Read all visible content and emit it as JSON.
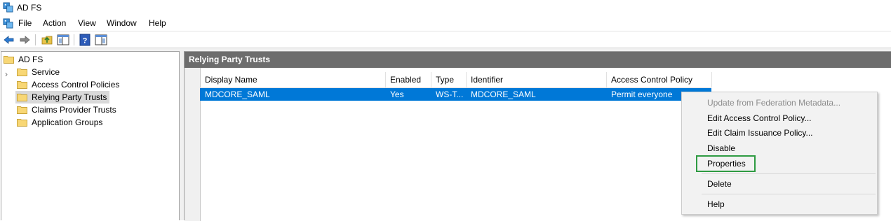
{
  "window": {
    "title": "AD FS"
  },
  "menubar": {
    "items": [
      "File",
      "Action",
      "View",
      "Window",
      "Help"
    ]
  },
  "toolbar": {
    "icons": [
      "back-arrow-icon",
      "forward-arrow-icon",
      "up-folder-icon",
      "show-hide-console-tree-icon",
      "help-icon",
      "show-hide-action-pane-icon"
    ]
  },
  "tree": {
    "root": "AD FS",
    "items": [
      "Service",
      "Access Control Policies",
      "Relying Party Trusts",
      "Claims Provider Trusts",
      "Application Groups"
    ],
    "selected": "Relying Party Trusts"
  },
  "panel": {
    "title": "Relying Party Trusts",
    "columns": [
      "Display Name",
      "Enabled",
      "Type",
      "Identifier",
      "Access Control Policy"
    ],
    "rows": [
      {
        "display_name": "MDCORE_SAML",
        "enabled": "Yes",
        "type": "WS-T...",
        "identifier": "MDCORE_SAML",
        "policy": "Permit everyone"
      }
    ]
  },
  "context_menu": {
    "items": [
      {
        "label": "Update from Federation Metadata...",
        "enabled": false
      },
      {
        "label": "Edit Access Control Policy...",
        "enabled": true
      },
      {
        "label": "Edit Claim Issuance Policy...",
        "enabled": true
      },
      {
        "label": "Disable",
        "enabled": true
      },
      {
        "label": "Properties",
        "enabled": true,
        "highlighted": true
      },
      {
        "label": "Delete",
        "enabled": true
      },
      {
        "label": "Help",
        "enabled": true
      }
    ]
  },
  "colors": {
    "selection": "#0078d7",
    "panel_header": "#6d6d6d",
    "highlight_box": "#2e9b42",
    "folder": "#f8d775"
  }
}
